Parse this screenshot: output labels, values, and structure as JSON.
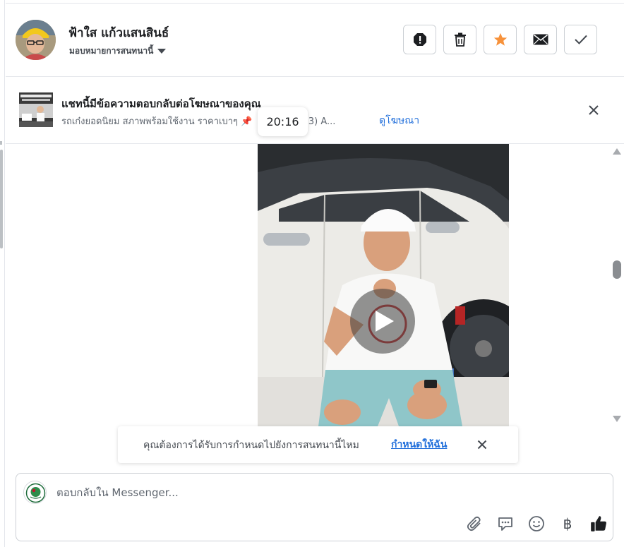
{
  "header": {
    "contact_name": "ฟ้าใส แก้วแสนสินธ์",
    "assign_label": "มอบหมายการสนทนานี้",
    "actions": [
      {
        "icon": "alert-octagon-icon",
        "name": "mark-spam-button"
      },
      {
        "icon": "trash-icon",
        "name": "delete-button"
      },
      {
        "icon": "star-icon",
        "name": "star-button"
      },
      {
        "icon": "envelope-icon",
        "name": "mark-unread-button"
      },
      {
        "icon": "checkmark-icon",
        "name": "mark-done-button"
      }
    ]
  },
  "ad_banner": {
    "title": "แชทนี้มีข้อความตอบกลับต่อโฆษณาของคุณ",
    "description": "รถเก๋งยอดนิยม สภาพพร้อมใช้งาน ราคาเบาๆ",
    "pin_icon": "📌",
    "description_tail": "5 E (MY13) A...",
    "view_ad_link": "ดูโฆษณา"
  },
  "tooltip": {
    "time": "20:16"
  },
  "messages": {
    "video": {
      "icon": "play-icon"
    }
  },
  "assign_prompt": {
    "text": "คุณต้องการได้รับการกำหนดไปยังการสนทนานี้ไหม",
    "link": "กำหนดให้ฉัน"
  },
  "composer": {
    "placeholder": "ตอบกลับใน Messenger...",
    "tools": [
      "paperclip-icon",
      "saved-replies-icon",
      "emoji-icon",
      "baht-icon",
      "thumbs-up-icon"
    ],
    "currency_symbol": "฿"
  },
  "colors": {
    "accent_link": "#216fdb",
    "star": "#f7923b",
    "border": "#ccd0d5"
  }
}
